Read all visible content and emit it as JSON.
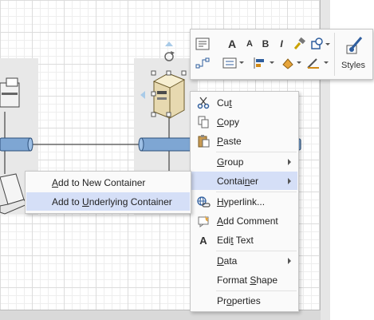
{
  "mini_toolbar": {
    "grow_font_icon": "A",
    "shrink_font_icon": "A",
    "bold_icon": "B",
    "italic_icon": "I",
    "styles_label": "Styles"
  },
  "context_menu": {
    "cut": {
      "pre": "Cu",
      "key": "t",
      "post": ""
    },
    "copy": {
      "pre": "",
      "key": "C",
      "post": "opy"
    },
    "paste": {
      "pre": "",
      "key": "P",
      "post": "aste"
    },
    "group": {
      "pre": "",
      "key": "G",
      "post": "roup"
    },
    "container": {
      "pre": "Contai",
      "key": "n",
      "post": "er"
    },
    "hyperlink": {
      "pre": "",
      "key": "H",
      "post": "yperlink..."
    },
    "add_comment": {
      "pre": "",
      "key": "A",
      "post": "dd Comment"
    },
    "edit_text": {
      "pre": "Edi",
      "key": "t",
      "post": " Text"
    },
    "data": {
      "pre": "",
      "key": "D",
      "post": "ata"
    },
    "format_shape": {
      "pre": "Format ",
      "key": "S",
      "post": "hape"
    },
    "properties": {
      "pre": "Pr",
      "key": "o",
      "post": "perties"
    }
  },
  "container_submenu": {
    "add_new": {
      "pre": "",
      "key": "A",
      "post": "dd to New Container"
    },
    "add_underlying": {
      "pre": "Add to ",
      "key": "U",
      "post": "nderlying Container"
    }
  },
  "edit_text_icon": "A"
}
